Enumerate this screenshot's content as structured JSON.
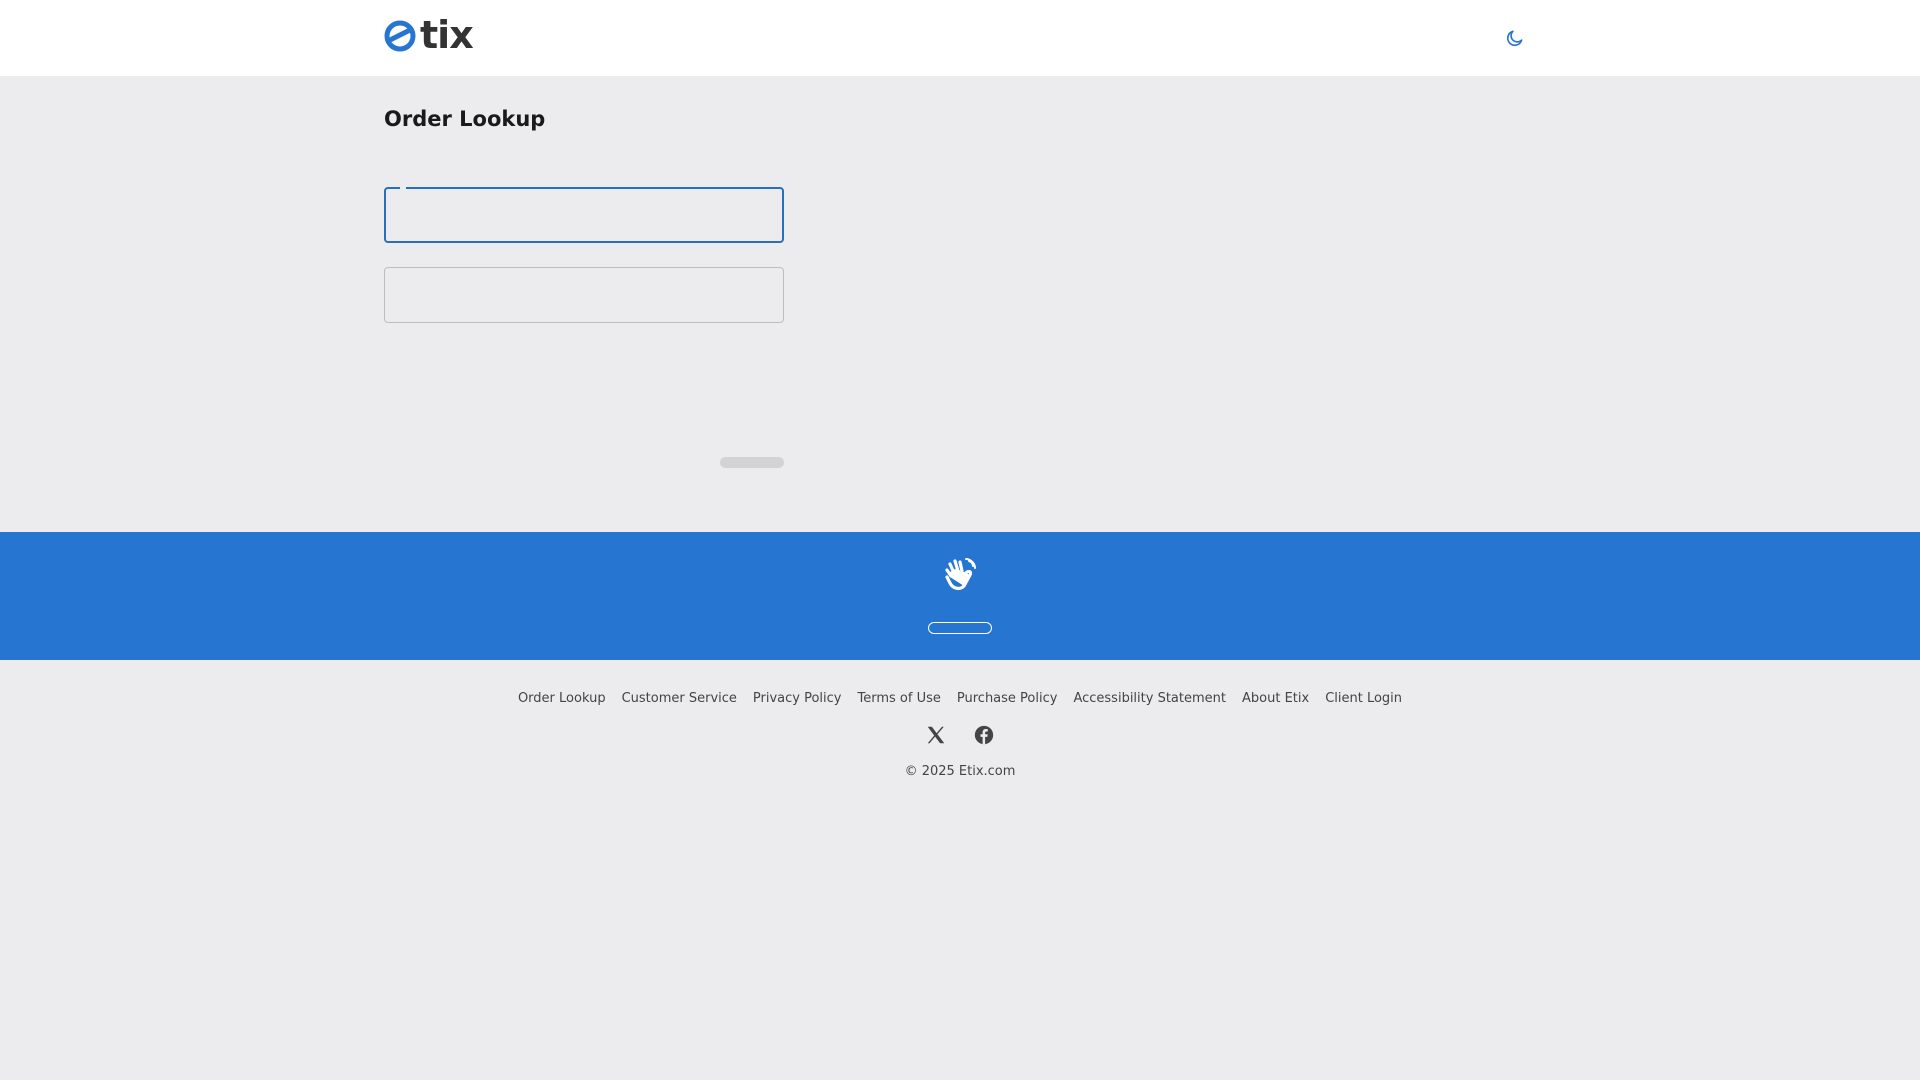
{
  "header": {
    "logo_text": "tix",
    "logo_brand": "etix",
    "theme_toggle_icon": "moon-icon"
  },
  "main": {
    "title": "Order Lookup",
    "fields": [
      {
        "value": "",
        "state": "focused"
      },
      {
        "value": "",
        "state": "default"
      }
    ],
    "submit_label": ""
  },
  "band": {
    "icon": "waving-hand-icon",
    "button_label": ""
  },
  "footer": {
    "links": [
      "Order Lookup",
      "Customer Service",
      "Privacy Policy",
      "Terms of Use",
      "Purchase Policy",
      "Accessibility Statement",
      "About Etix",
      "Client Login"
    ],
    "social_icons": [
      "x-twitter-icon",
      "facebook-icon"
    ],
    "copyright": "© 2025 Etix.com"
  },
  "colors": {
    "brand_blue": "#2675d1",
    "focus_border": "#2a6fbd",
    "page_bg": "#ececee",
    "header_bg": "#ffffff"
  }
}
